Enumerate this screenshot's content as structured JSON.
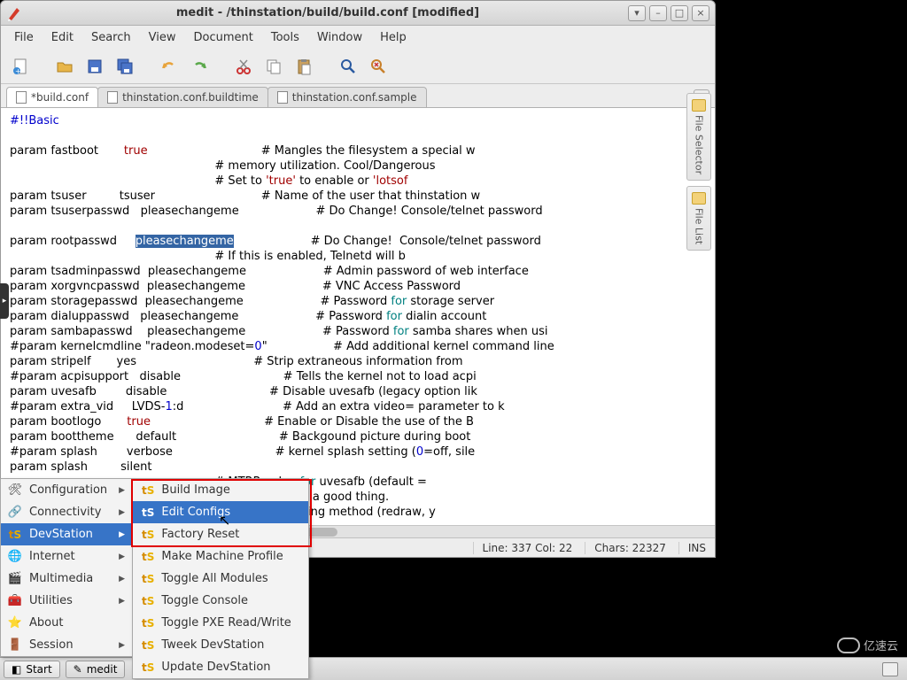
{
  "window": {
    "title": "medit - /thinstation/build/build.conf [modified]"
  },
  "menus": [
    "File",
    "Edit",
    "Search",
    "View",
    "Document",
    "Tools",
    "Window",
    "Help"
  ],
  "toolbar_icons": [
    "new",
    "open",
    "save",
    "save-all",
    "undo",
    "redo",
    "cut",
    "copy",
    "paste",
    "find",
    "find-replace"
  ],
  "tabs": [
    {
      "label": "*build.conf",
      "active": true
    },
    {
      "label": "thinstation.conf.buildtime",
      "active": false
    },
    {
      "label": "thinstation.conf.sample",
      "active": false
    }
  ],
  "right_tabs": [
    "File Selector",
    "File List"
  ],
  "statusbar": {
    "pos": "Line: 337 Col: 22",
    "chars": "Chars: 22327",
    "mode": "INS"
  },
  "code": {
    "l0": "#!!Basic",
    "l1a": "param fastboot       ",
    "l1b": "true",
    "l1c": "                               # Mangles the filesystem a special w",
    "l2": "                                                        # memory utilization. Cool/Dangerous",
    "l3a": "                                                        # Set to ",
    "l3b": "'true'",
    "l3c": " to enable or ",
    "l3d": "'lotsof",
    "l4": "param tsuser         tsuser                             # Name of the user that thinstation w",
    "l5": "param tsuserpasswd   pleasechangeme                     # Do Change! Console/telnet password",
    "l6a": "param rootpasswd     ",
    "l6b": "pleasechangeme",
    "l6c": "                     # Do Change!  Console/telnet password",
    "l7": "                                                        # If this is enabled, Telnetd will b",
    "l8": "param tsadminpasswd  pleasechangeme                     # Admin password of web interface",
    "l9": "param xorgvncpasswd  pleasechangeme                     # VNC Access Password",
    "l10a": "param storagepasswd  pleasechangeme                     # Password ",
    "l10b": "for",
    "l10c": " storage server",
    "l11a": "param dialuppasswd   pleasechangeme                     # Password ",
    "l11b": "for",
    "l11c": " dialin account",
    "l12a": "param sambapasswd    pleasechangeme                     # Password ",
    "l12b": "for",
    "l12c": " samba shares when usi",
    "l13a": "#param kernelcmdline \"radeon.modeset=",
    "l13b": "0",
    "l13c": "\"                  # Add additional kernel command line",
    "l14": "param stripelf       yes                                # Strip extraneous information from ",
    "l15": "#param acpisupport   disable                            # Tells the kernel not to load acpi",
    "l16": "param uvesafb        disable                            # Disable uvesafb (legacy option lik",
    "l17a": "#param extra_vid     LVDS-",
    "l17b": "1",
    "l17c": ":d                           # Add an extra video= parameter to k",
    "l18a": "param bootlogo       ",
    "l18b": "true",
    "l18c": "                               # Enable or Disable the use of the B",
    "l19": "param boottheme      default                            # Backgound picture during boot",
    "l20a": "#param splash        verbose                            # kernel splash setting (",
    "l20b": "0",
    "l20c": "=off, sile",
    "l21": "param splash         silent",
    "l22a": "                                                        # MTRR value ",
    "l22b": "for",
    "l22c": " uvesafb (default = ",
    "l23": "                                                        # This is usually a good thing.",
    "l24": "                                                        # Window scrolling method (redraw, y"
  },
  "startmenu": [
    {
      "name": "configuration",
      "label": "Configuration",
      "icon": "🛠",
      "arrow": true,
      "hl": false
    },
    {
      "name": "connectivity",
      "label": "Connectivity",
      "icon": "🔗",
      "arrow": true,
      "hl": false
    },
    {
      "name": "devstation",
      "label": "DevStation",
      "icon": "",
      "arrow": true,
      "hl": true
    },
    {
      "name": "internet",
      "label": "Internet",
      "icon": "🌐",
      "arrow": true,
      "hl": false
    },
    {
      "name": "multimedia",
      "label": "Multimedia",
      "icon": "🎬",
      "arrow": true,
      "hl": false
    },
    {
      "name": "utilities",
      "label": "Utilities",
      "icon": "🧰",
      "arrow": true,
      "hl": false
    },
    {
      "name": "about",
      "label": "About",
      "icon": "⭐",
      "arrow": false,
      "hl": false
    },
    {
      "name": "session",
      "label": "Session",
      "icon": "🚪",
      "arrow": true,
      "hl": false
    }
  ],
  "submenu": [
    {
      "label": "Build Image",
      "hl": false
    },
    {
      "label": "Edit Configs",
      "hl": true
    },
    {
      "label": "Factory Reset",
      "hl": false
    },
    {
      "label": "Make Machine Profile",
      "hl": false
    },
    {
      "label": "Toggle All Modules",
      "hl": false
    },
    {
      "label": "Toggle Console",
      "hl": false
    },
    {
      "label": "Toggle PXE Read/Write",
      "hl": false
    },
    {
      "label": "Tweek DevStation",
      "hl": false
    },
    {
      "label": "Update DevStation",
      "hl": false
    }
  ],
  "taskbar": {
    "start": "Start",
    "task": "medit"
  },
  "watermark": "亿速云"
}
